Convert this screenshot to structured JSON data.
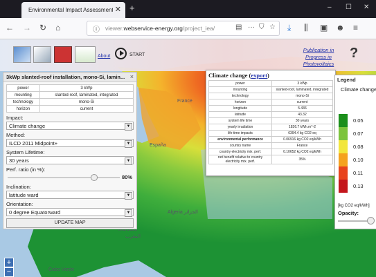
{
  "browser": {
    "tab_title": "Environmental Impact Assessment",
    "tab_close": "✕",
    "new_tab": "+",
    "window_buttons": [
      "–",
      "☐",
      "✕"
    ],
    "url_prefix": "viewer.",
    "url_domain": "webservice-energy.org",
    "url_path": "/project_iea/",
    "url_actions": [
      "▤",
      "···",
      "⛉",
      "☆"
    ],
    "toolbar_icons": [
      "⤓",
      "⫼",
      "▣",
      "☻",
      "≡"
    ]
  },
  "app": {
    "about": "About",
    "start": "START",
    "publication_line1": "Publication in",
    "publication_line2": "Progress in Photovoltaics",
    "help": "?"
  },
  "panel": {
    "title": "3kWp slanted-roof installation, mono-Si, lamin...",
    "close": "×",
    "specs": [
      [
        "power",
        "3 kWp"
      ],
      [
        "mounting",
        "slanted-roof, laminated, integrated"
      ],
      [
        "technology",
        "mono-Si"
      ],
      [
        "horizon",
        "current"
      ]
    ],
    "impact_label": "Impact:",
    "impact_value": "Climate change",
    "method_label": "Method:",
    "method_value": "ILCD 2011 Midpoint+",
    "lifetime_label": "System Lifetime:",
    "lifetime_value": "30 years",
    "perf_label": "Perf. ratio (in %):",
    "perf_value": "80%",
    "perf_ratio": 0.8,
    "inclination_label": "Inclination:",
    "inclination_value": "latitude ward",
    "orientation_label": "Orientation:",
    "orientation_value": "0 degree Equatorward",
    "update_button": "UPDATE MAP"
  },
  "popup": {
    "title": "Climate change",
    "export_link": "export",
    "rows": [
      [
        "power",
        "3 kWp"
      ],
      [
        "mounting",
        "slanted-roof, laminated, integrated"
      ],
      [
        "technology",
        "mono-Si"
      ],
      [
        "horizon",
        "current"
      ],
      [
        "longitude",
        "5.436"
      ],
      [
        "latitude",
        "43.32"
      ],
      [
        "system life time",
        "30 years"
      ],
      [
        "yearly irradiation",
        "1826.7 kWh.m^-2"
      ],
      [
        "life time impacts",
        "6394.4 kg CO2 eq"
      ],
      [
        "environmental performance",
        "0.06916 kg CO2 eq/kWh"
      ],
      [
        "country name",
        "France"
      ],
      [
        "country electricity mix. perf.",
        "0.10652 kg CO2 eq/kWh"
      ],
      [
        "net benefit relative to country electricity mix. perf.",
        "35%"
      ]
    ]
  },
  "legend": {
    "title": "Legend",
    "subtitle": "Climate change",
    "entries": [
      {
        "value": "0.05",
        "color": "#1b8f1b"
      },
      {
        "value": "0.07",
        "color": "#7cc43c"
      },
      {
        "value": "0.08",
        "color": "#f2e63c"
      },
      {
        "value": "0.10",
        "color": "#f5a21e"
      },
      {
        "value": "0.11",
        "color": "#e8421c"
      },
      {
        "value": "0.13",
        "color": "#c4161c"
      }
    ],
    "unit": "[kg CO2 eq/kWh]",
    "opacity_label": "Opacity:"
  },
  "map": {
    "labels": [
      "France",
      "España",
      "Algeria الجزائر",
      "Morocco",
      "المغرب",
      "Cabo Verde"
    ],
    "zoom_in": "+",
    "zoom_out": "−"
  }
}
